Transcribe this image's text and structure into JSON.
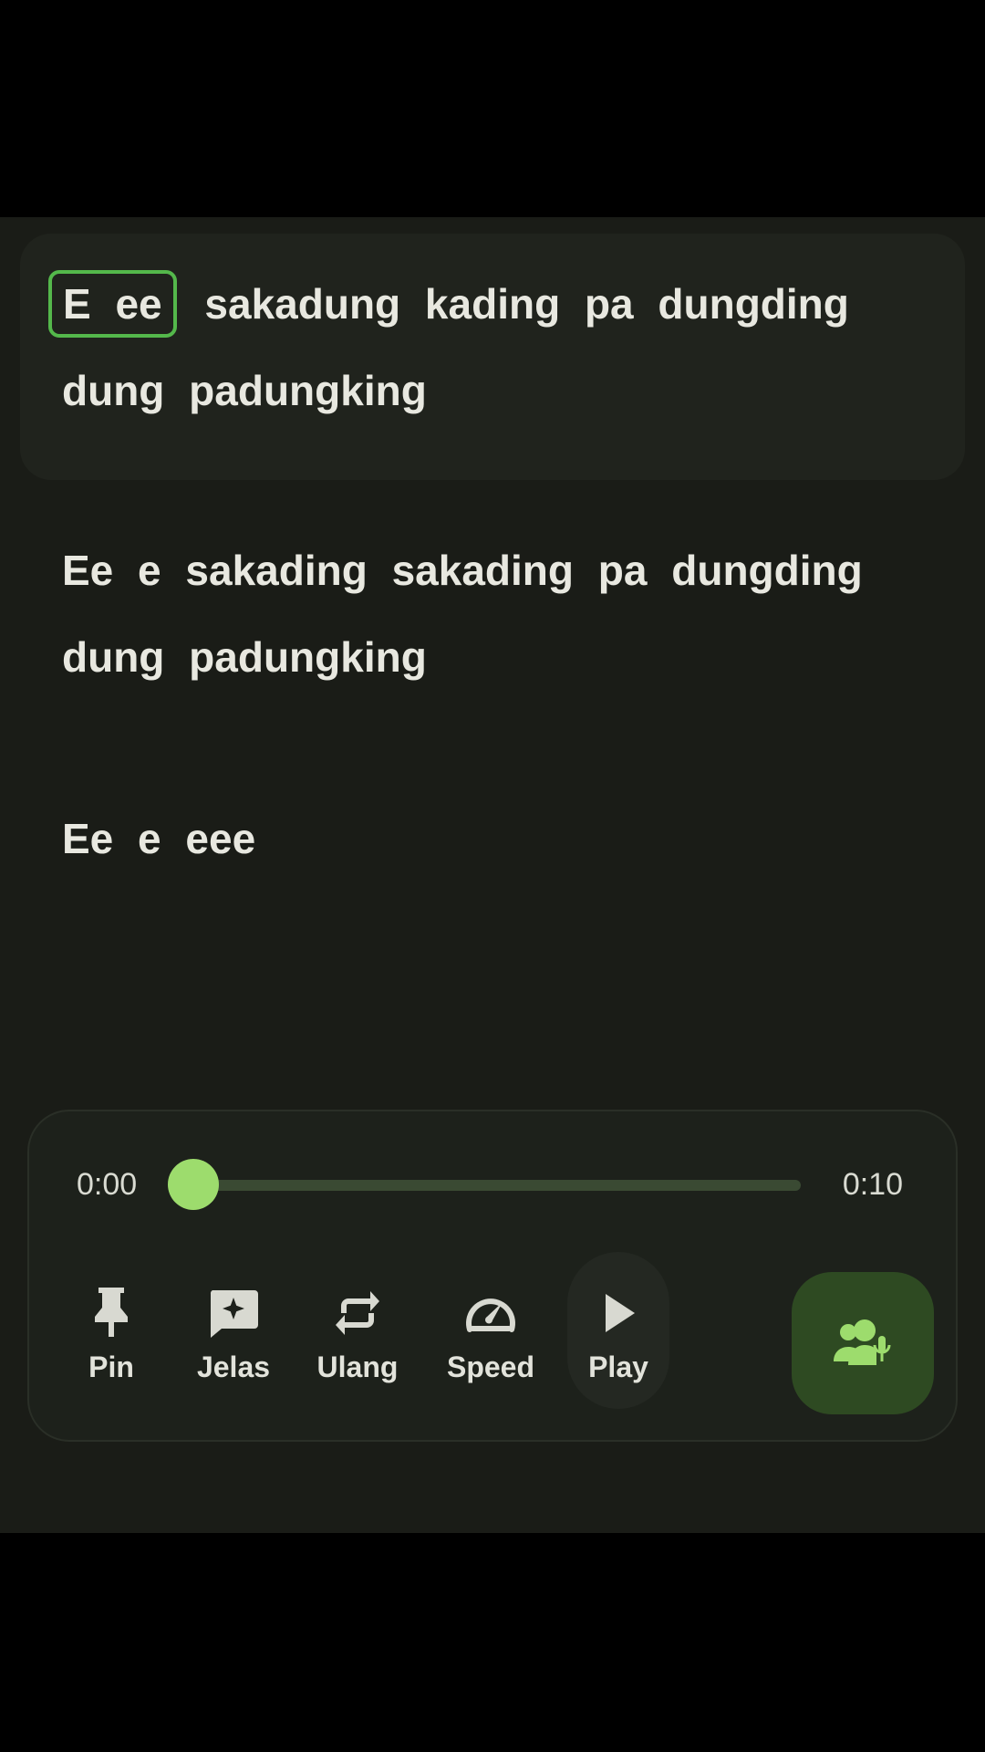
{
  "lyrics": {
    "line1": {
      "highlighted_word": "E ee",
      "rest_row1": "sakadung kading pa dungding",
      "row2": "dung padungking"
    },
    "line2": {
      "row1": "Ee e sakading sakading pa dungding",
      "row2": "dung padungking"
    },
    "line3": {
      "row1": "Ee e eee"
    }
  },
  "player": {
    "time_current": "0:00",
    "time_total": "0:10",
    "progress": 0.0,
    "controls": {
      "pin": "Pin",
      "jelas": "Jelas",
      "ulang": "Ulang",
      "speed": "Speed",
      "play": "Play"
    },
    "mic_button_icon": "group-mic-icon"
  },
  "colors": {
    "background": "#1a1c17",
    "accent": "#9ddc6d",
    "highlight_border": "#54b84b",
    "mic_button_bg": "#2e4a22"
  }
}
